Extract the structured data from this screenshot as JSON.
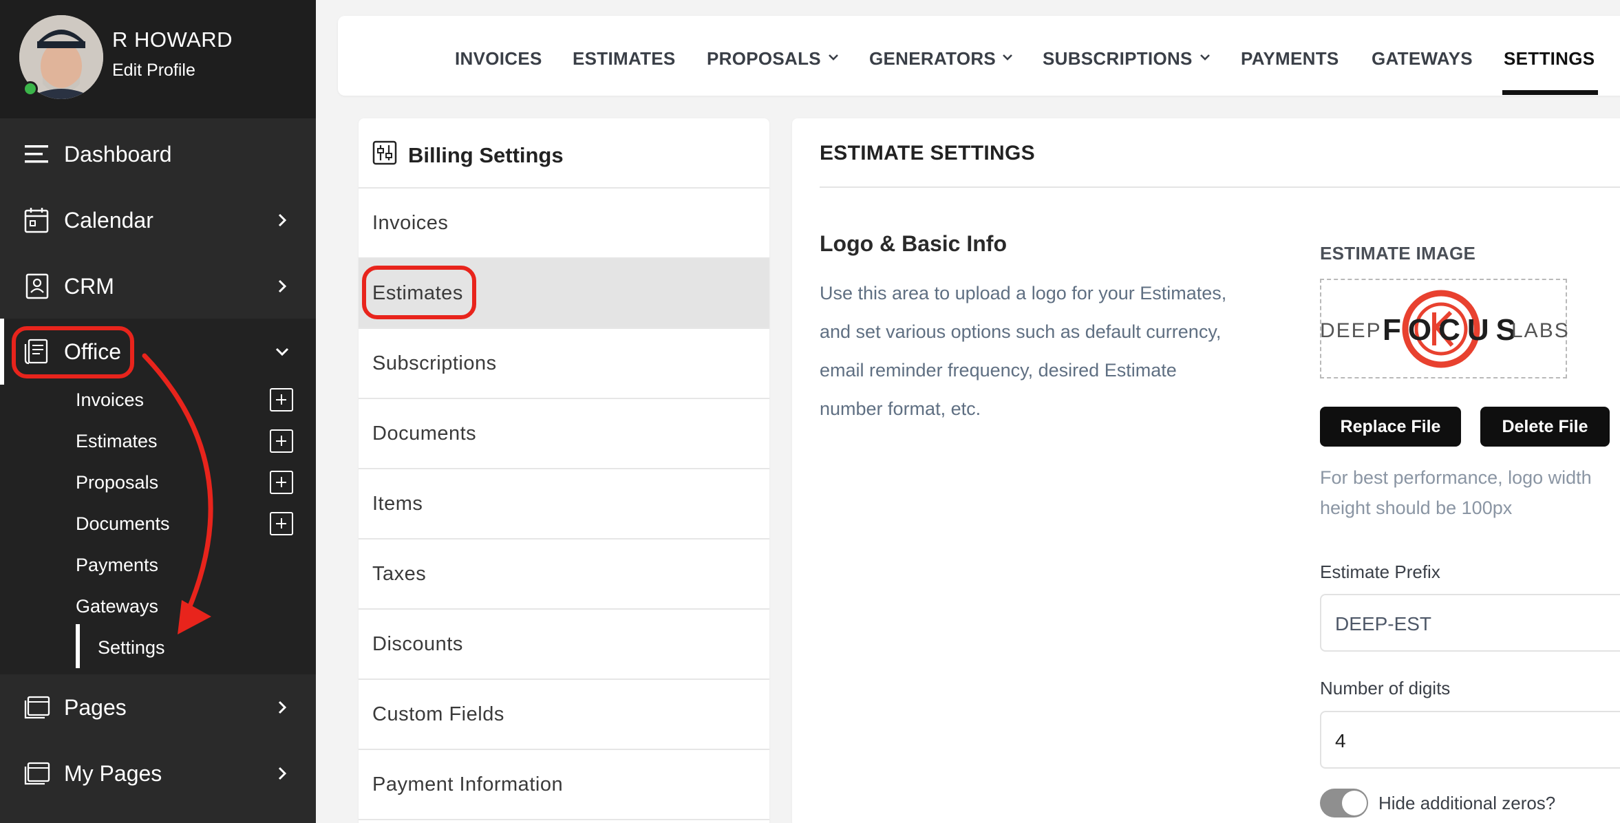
{
  "profile": {
    "name": "R HOWARD",
    "edit_label": "Edit Profile"
  },
  "sidebar": {
    "items": [
      {
        "label": "Dashboard",
        "icon": "menu-icon"
      },
      {
        "label": "Calendar",
        "icon": "calendar-icon"
      },
      {
        "label": "CRM",
        "icon": "contact-card-icon"
      },
      {
        "label": "Office",
        "icon": "office-document-icon"
      },
      {
        "label": "Pages",
        "icon": "pages-icon"
      },
      {
        "label": "My Pages",
        "icon": "pages-icon"
      }
    ],
    "office_submenu": [
      "Invoices",
      "Estimates",
      "Proposals",
      "Documents",
      "Payments",
      "Gateways",
      "Settings"
    ],
    "active_submenu": "Settings"
  },
  "topnav": {
    "tabs": [
      "INVOICES",
      "ESTIMATES",
      "PROPOSALS",
      "GENERATORS",
      "SUBSCRIPTIONS",
      "PAYMENTS",
      "GATEWAYS",
      "SETTINGS"
    ],
    "active_tab": "SETTINGS"
  },
  "billing": {
    "title": "Billing Settings",
    "items": [
      "Invoices",
      "Estimates",
      "Subscriptions",
      "Documents",
      "Items",
      "Taxes",
      "Discounts",
      "Custom Fields",
      "Payment Information"
    ],
    "active": "Estimates"
  },
  "estimate": {
    "title": "ESTIMATE SETTINGS",
    "section_title": "Logo & Basic Info",
    "section_desc": "Use this area to upload a logo for your Estimates, and set various options such as default currency, email reminder frequency, desired Estimate number format, etc.",
    "image_label": "ESTIMATE IMAGE",
    "logo": {
      "left": "DEEP",
      "center": "FOCUS",
      "right": "LABS"
    },
    "replace_label": "Replace File",
    "delete_label": "Delete File",
    "hint": "For best performance, logo width height should be 100px",
    "prefix_label": "Estimate Prefix",
    "prefix_value": "DEEP-EST",
    "digits_label": "Number of digits",
    "digits_value": "4",
    "hide_zeros_label": "Hide additional zeros?"
  },
  "colors": {
    "annotation": "#e8241c",
    "sidebar_bg": "#2a2a2a",
    "online": "#3bb54a"
  }
}
